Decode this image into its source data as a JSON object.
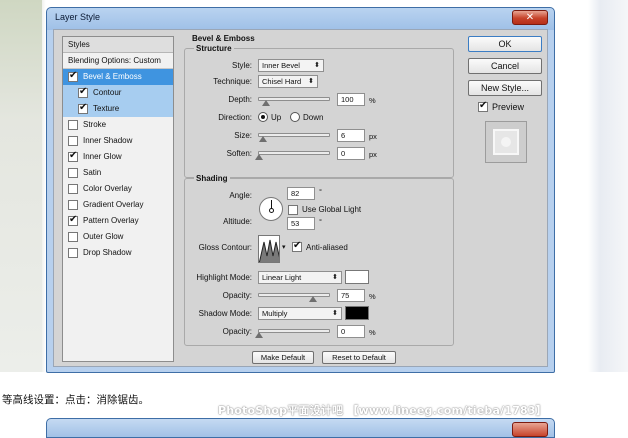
{
  "window": {
    "title": "Layer Style",
    "close_icon": "close-icon"
  },
  "styles_panel": {
    "header": "Styles",
    "blending_options": "Blending Options: Custom",
    "items": [
      {
        "label": "Bevel & Emboss",
        "checked": true,
        "state": "active"
      },
      {
        "label": "Contour",
        "checked": true,
        "state": "sub"
      },
      {
        "label": "Texture",
        "checked": true,
        "state": "sub"
      },
      {
        "label": "Stroke",
        "checked": false,
        "state": "normal"
      },
      {
        "label": "Inner Shadow",
        "checked": false,
        "state": "normal"
      },
      {
        "label": "Inner Glow",
        "checked": true,
        "state": "normal"
      },
      {
        "label": "Satin",
        "checked": false,
        "state": "normal"
      },
      {
        "label": "Color Overlay",
        "checked": false,
        "state": "normal"
      },
      {
        "label": "Gradient Overlay",
        "checked": false,
        "state": "normal"
      },
      {
        "label": "Pattern Overlay",
        "checked": true,
        "state": "normal"
      },
      {
        "label": "Outer Glow",
        "checked": false,
        "state": "normal"
      },
      {
        "label": "Drop Shadow",
        "checked": false,
        "state": "normal"
      }
    ]
  },
  "bevel": {
    "section_title": "Bevel & Emboss",
    "structure_title": "Structure",
    "style_label": "Style:",
    "style_value": "Inner Bevel",
    "technique_label": "Technique:",
    "technique_value": "Chisel Hard",
    "depth_label": "Depth:",
    "depth_value": "100",
    "depth_unit": "%",
    "depth_level": 0.1,
    "direction_label": "Direction:",
    "direction_up": "Up",
    "direction_down": "Down",
    "direction_selected": "Up",
    "size_label": "Size:",
    "size_value": "6",
    "size_unit": "px",
    "size_level": 0.05,
    "soften_label": "Soften:",
    "soften_value": "0",
    "soften_unit": "px",
    "soften_level": 0.0
  },
  "shading": {
    "title": "Shading",
    "angle_label": "Angle:",
    "angle_value": "82",
    "angle_unit": "°",
    "use_global_light": "Use Global Light",
    "use_global_light_checked": false,
    "altitude_label": "Altitude:",
    "altitude_value": "53",
    "altitude_unit": "°",
    "gloss_contour_label": "Gloss Contour:",
    "anti_aliased": "Anti-aliased",
    "anti_aliased_checked": true,
    "highlight_mode_label": "Highlight Mode:",
    "highlight_mode_value": "Linear Light",
    "highlight_color": "#ffffff",
    "highlight_opacity_label": "Opacity:",
    "highlight_opacity_value": "75",
    "highlight_opacity_unit": "%",
    "highlight_opacity_level": 0.75,
    "shadow_mode_label": "Shadow Mode:",
    "shadow_mode_value": "Multiply",
    "shadow_color": "#000000",
    "shadow_opacity_label": "Opacity:",
    "shadow_opacity_value": "0",
    "shadow_opacity_unit": "%",
    "shadow_opacity_level": 0.0
  },
  "footer": {
    "make_default": "Make Default",
    "reset_to_default": "Reset to Default"
  },
  "side_buttons": {
    "ok": "OK",
    "cancel": "Cancel",
    "new_style": "New Style...",
    "preview": "Preview",
    "preview_checked": true
  },
  "caption": "等高线设置：点击：消除锯齿。",
  "watermark": "PhotoShop平面设计吧 【www.lineeg.com/tieba/1783】"
}
